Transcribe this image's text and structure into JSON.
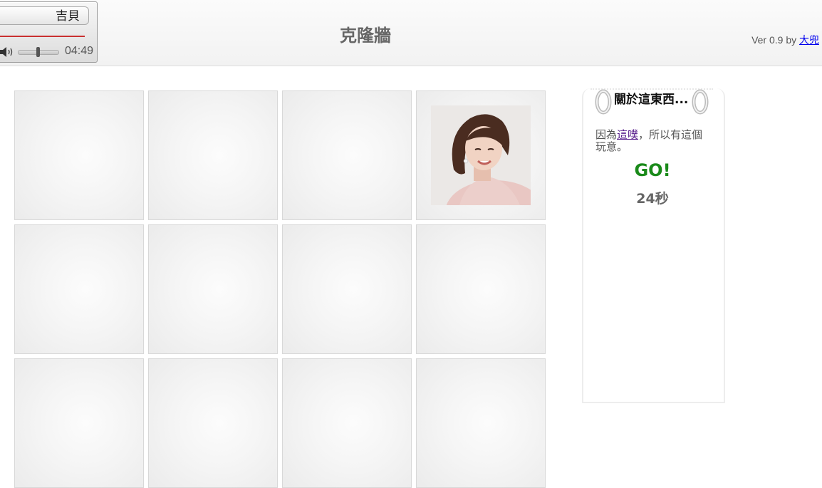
{
  "player": {
    "song_title": "吉貝",
    "time": "04:49",
    "progress": 1.0,
    "volume": 0.5
  },
  "header": {
    "title": "克隆牆",
    "version_prefix": "Ver 0.9 by ",
    "author_link": "大兜"
  },
  "grid": {
    "columns": 4,
    "rows_visible": 3,
    "revealed_tile": "r1c4"
  },
  "sidebar": {
    "heading": "關於這東西...",
    "desc_before": "因為",
    "desc_link": "這噗",
    "desc_after": "，所以有這個玩意。",
    "go_label": "GO!",
    "timer": "24秒"
  },
  "colors": {
    "go": "#1a8a1a",
    "progress": "#c93030",
    "link": "#0000ee"
  },
  "icons": {
    "volume": "volume-icon",
    "ring": "binder-ring-icon"
  }
}
